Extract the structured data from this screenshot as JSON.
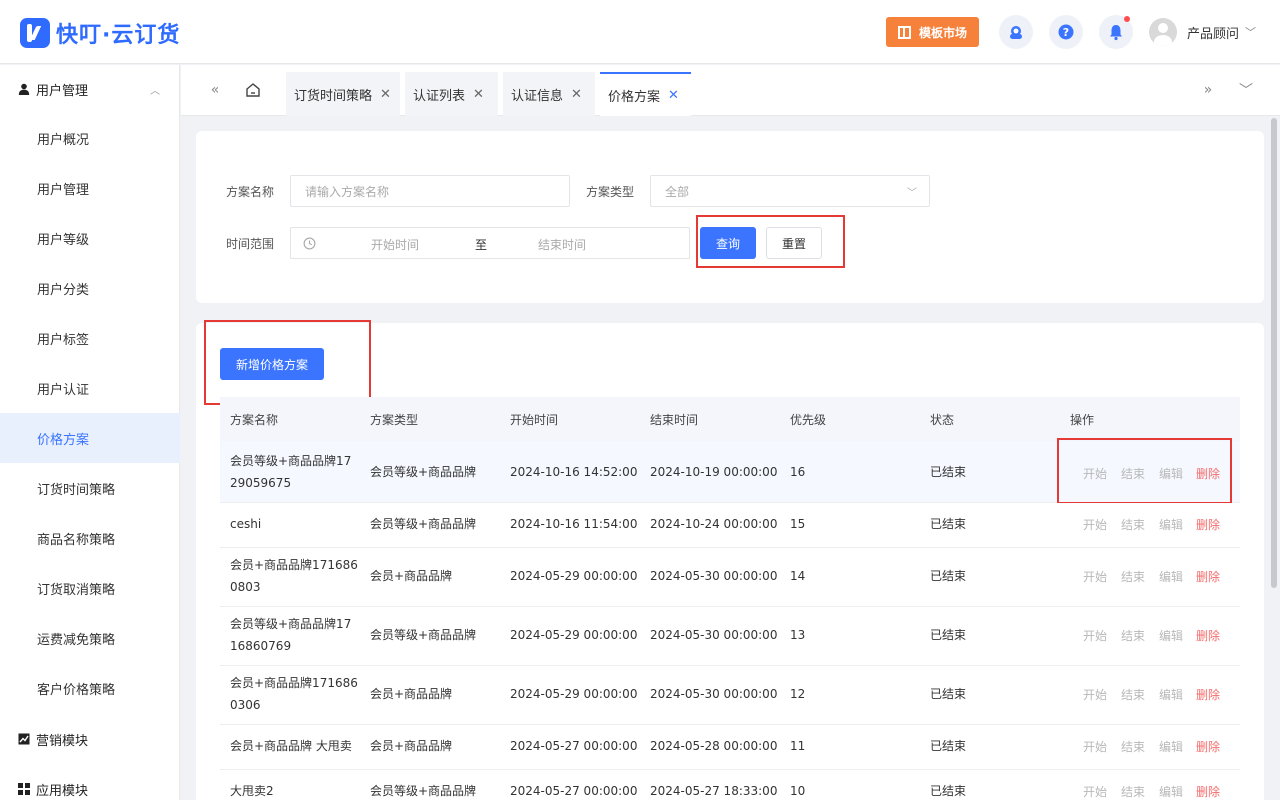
{
  "app": {
    "name": "快叮·云订货",
    "market_button": "模板市场",
    "user_name": "产品顾问"
  },
  "sidebar": {
    "groups": [
      {
        "label": "用户管理"
      },
      {
        "label": "营销模块"
      },
      {
        "label": "应用模块"
      }
    ],
    "items": [
      {
        "label": "用户概况"
      },
      {
        "label": "用户管理"
      },
      {
        "label": "用户等级"
      },
      {
        "label": "用户分类"
      },
      {
        "label": "用户标签"
      },
      {
        "label": "用户认证"
      },
      {
        "label": "价格方案"
      },
      {
        "label": "订货时间策略"
      },
      {
        "label": "商品名称策略"
      },
      {
        "label": "订货取消策略"
      },
      {
        "label": "运费减免策略"
      },
      {
        "label": "客户价格策略"
      }
    ]
  },
  "tabs": [
    {
      "label": "订货时间策略"
    },
    {
      "label": "认证列表"
    },
    {
      "label": "认证信息"
    },
    {
      "label": "价格方案"
    }
  ],
  "filter": {
    "name_label": "方案名称",
    "name_placeholder": "请输入方案名称",
    "type_label": "方案类型",
    "type_value": "全部",
    "time_label": "时间范围",
    "start_placeholder": "开始时间",
    "range_sep": "至",
    "end_placeholder": "结束时间",
    "query_button": "查询",
    "reset_button": "重置"
  },
  "add_button": "新增价格方案",
  "table": {
    "columns": [
      "方案名称",
      "方案类型",
      "开始时间",
      "结束时间",
      "优先级",
      "状态",
      "操作"
    ],
    "actions": {
      "start": "开始",
      "end": "结束",
      "edit": "编辑",
      "delete": "删除"
    },
    "rows": [
      {
        "name1": "会员等级+商品品牌17",
        "name2": "29059675",
        "type": "会员等级+商品品牌",
        "start": "2024-10-16 14:52:00",
        "end": "2024-10-19 00:00:00",
        "priority": "16",
        "status": "已结束"
      },
      {
        "name1": "ceshi",
        "name2": "",
        "type": "会员等级+商品品牌",
        "start": "2024-10-16 11:54:00",
        "end": "2024-10-24 00:00:00",
        "priority": "15",
        "status": "已结束"
      },
      {
        "name1": "会员+商品品牌171686",
        "name2": "0803",
        "type": "会员+商品品牌",
        "start": "2024-05-29 00:00:00",
        "end": "2024-05-30 00:00:00",
        "priority": "14",
        "status": "已结束"
      },
      {
        "name1": "会员等级+商品品牌17",
        "name2": "16860769",
        "type": "会员等级+商品品牌",
        "start": "2024-05-29 00:00:00",
        "end": "2024-05-30 00:00:00",
        "priority": "13",
        "status": "已结束"
      },
      {
        "name1": "会员+商品品牌171686",
        "name2": "0306",
        "type": "会员+商品品牌",
        "start": "2024-05-29 00:00:00",
        "end": "2024-05-30 00:00:00",
        "priority": "12",
        "status": "已结束"
      },
      {
        "name1": "会员+商品品牌 大甩卖",
        "name2": "",
        "type": "会员+商品品牌",
        "start": "2024-05-27 00:00:00",
        "end": "2024-05-28 00:00:00",
        "priority": "11",
        "status": "已结束"
      },
      {
        "name1": "大甩卖2",
        "name2": "",
        "type": "会员等级+商品品牌",
        "start": "2024-05-27 00:00:00",
        "end": "2024-05-27 18:33:00",
        "priority": "10",
        "status": "已结束"
      }
    ]
  },
  "colors": {
    "primary": "#3a74ff",
    "brand": "#2f6bff",
    "market": "#f5813b",
    "danger": "#f56c6c",
    "highlight_box": "#e53935"
  }
}
